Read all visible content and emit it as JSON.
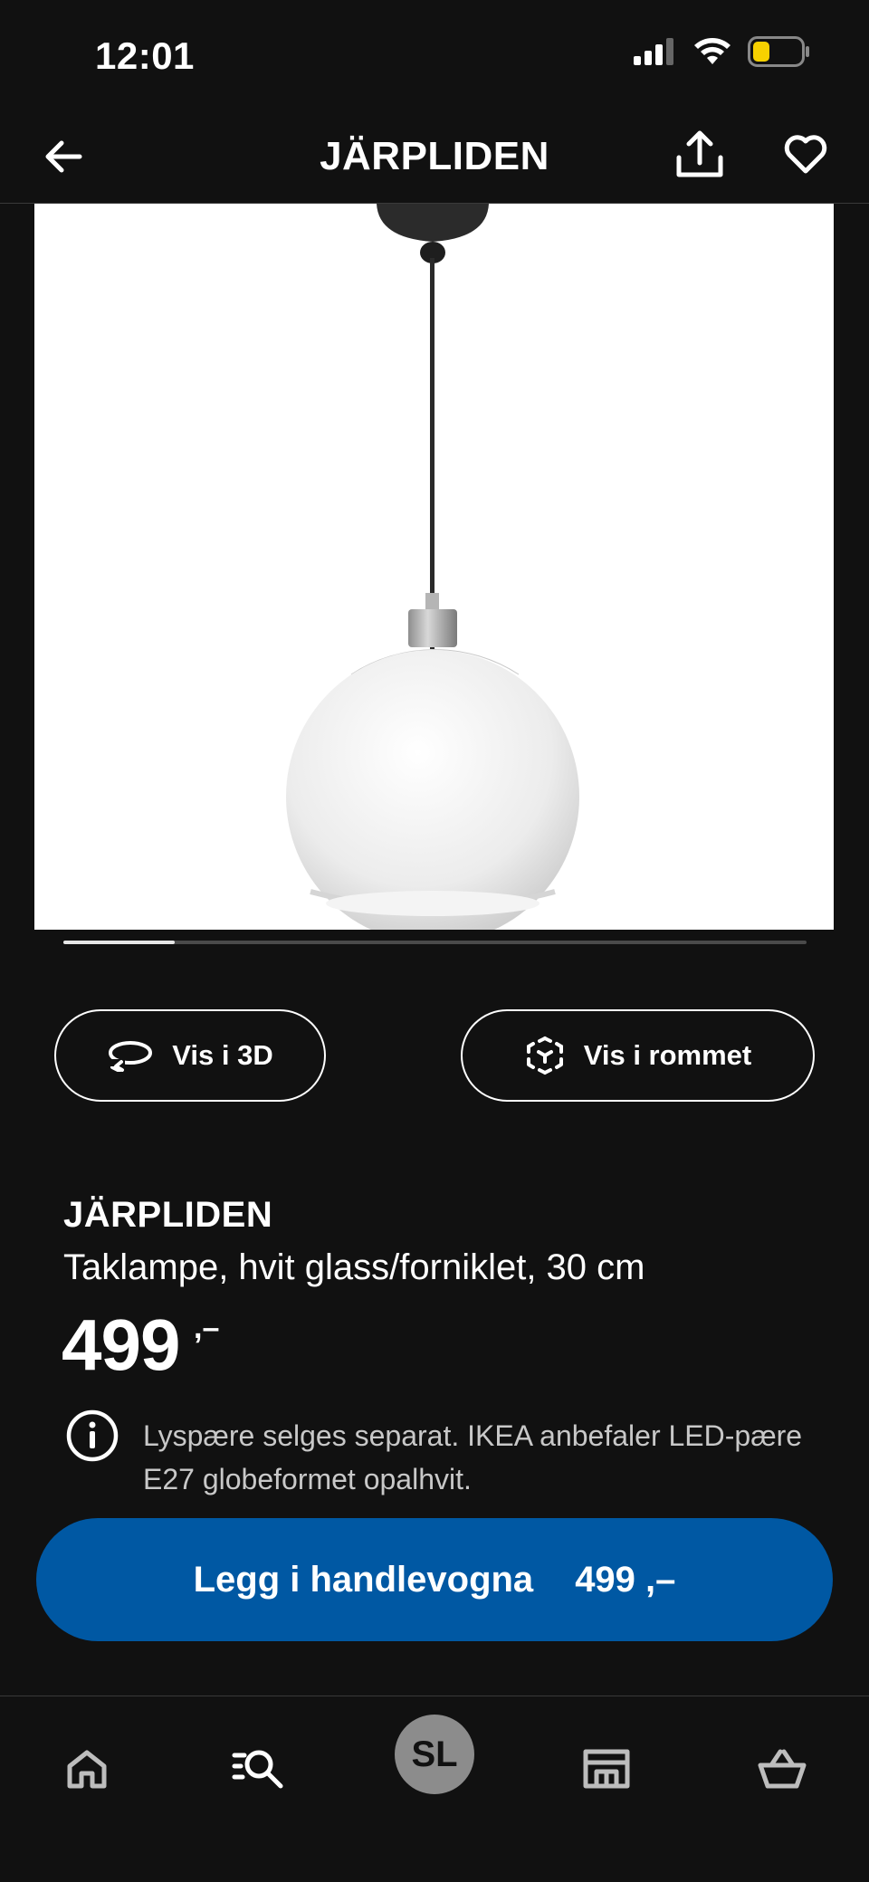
{
  "status_bar": {
    "time": "12:01"
  },
  "header": {
    "title": "JÄRPLIDEN",
    "back_icon": "arrow-left-icon",
    "share_icon": "share-icon",
    "favorite_icon": "heart-icon"
  },
  "gallery": {
    "progress_fraction": 0.15
  },
  "actions": {
    "view_3d_label": "Vis i 3D",
    "view_room_label": "Vis i rommet"
  },
  "product": {
    "name": "JÄRPLIDEN",
    "description": "Taklampe, hvit glass/forniklet, 30 cm",
    "price": "499",
    "price_suffix": ",–",
    "info_text": "Lyspære selges separat. IKEA anbefaler LED-pære E27 globeformet opalhvit."
  },
  "cta": {
    "label": "Legg i handlevogna",
    "price": "499 ,–",
    "color": "#0058a3"
  },
  "bottom_nav": {
    "items": [
      {
        "name": "home",
        "icon": "home-icon"
      },
      {
        "name": "search",
        "icon": "search-list-icon"
      },
      {
        "name": "profile",
        "avatar_initials": "SL"
      },
      {
        "name": "store",
        "icon": "store-icon"
      },
      {
        "name": "cart",
        "icon": "basket-icon"
      }
    ]
  }
}
